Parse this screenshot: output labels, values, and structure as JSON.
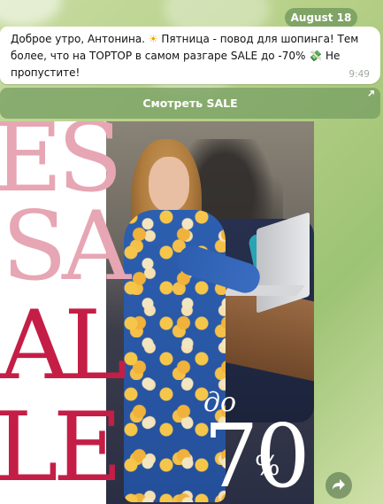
{
  "chat": {
    "date_label": "August 18",
    "message": {
      "text_part1": "Доброе утро, Антонина. ",
      "sun_emoji": "☀",
      "text_part2": " Пятница - повод для шопинга! Тем более, что на TOPTOP в самом разгаре SALE до -70% ",
      "money_emoji": "💸",
      "text_part3": " Не пропустите!",
      "time": "9:49"
    },
    "inline_button": {
      "label": "Смотреть SALE",
      "icon": "external-link-arrow-icon"
    },
    "photo": {
      "letters": [
        "ES",
        "SA",
        "AL",
        "LE"
      ],
      "do_label": "до",
      "percent_value": "70",
      "percent_sign": "%",
      "accent_color": "#c41e46",
      "light_color": "#e7a6b4"
    },
    "share_button_icon": "share-arrow-icon"
  }
}
